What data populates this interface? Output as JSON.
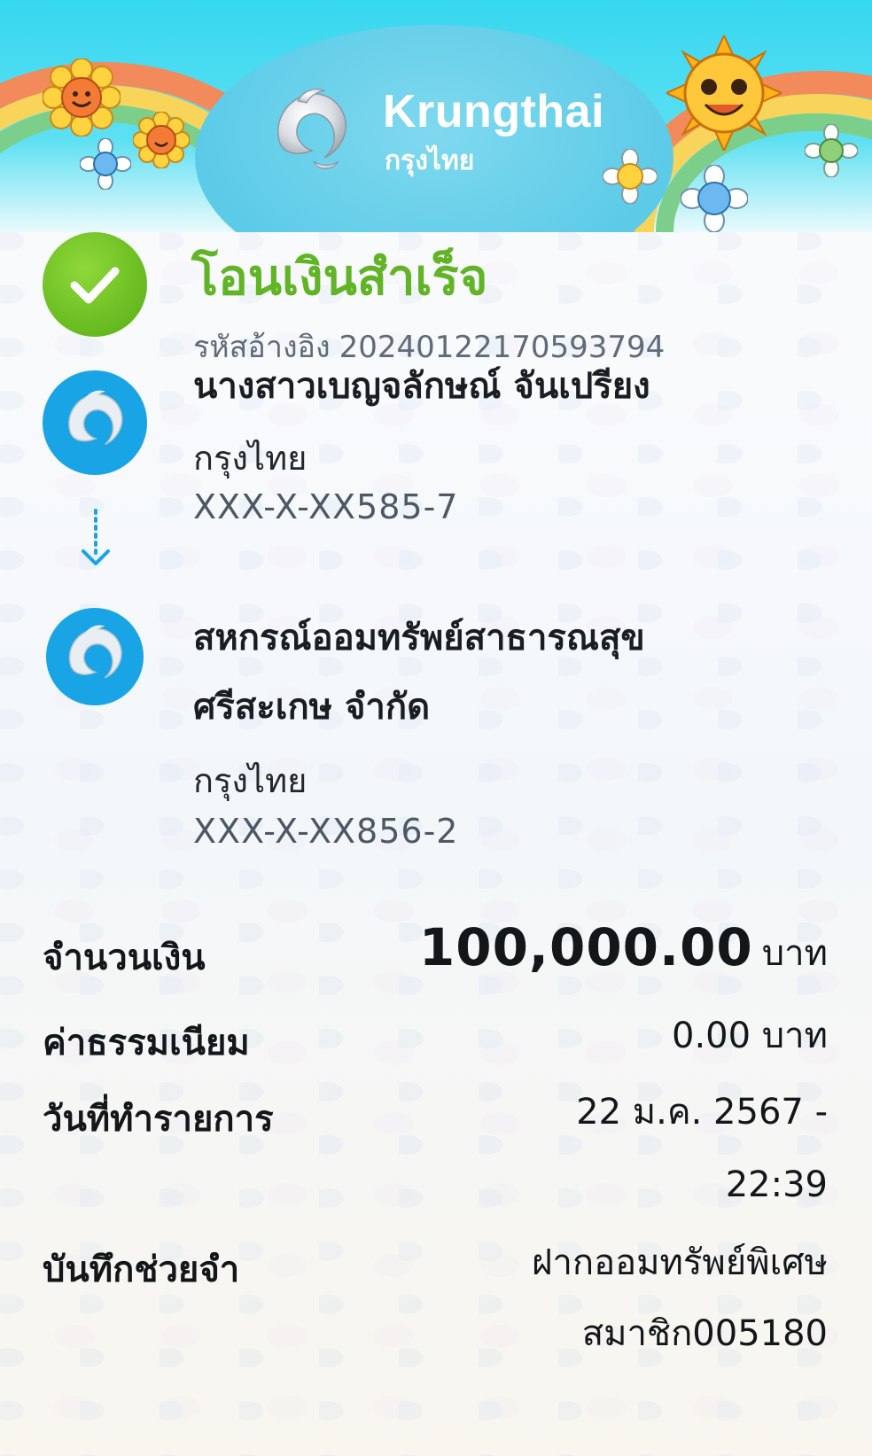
{
  "header": {
    "brand_en": "Krungthai",
    "brand_th": "กรุงไทย",
    "colors": {
      "sky": "#36d7f0",
      "brand_blue": "#19a4e5",
      "success_green": "#61b426"
    }
  },
  "status": {
    "title": "โอนเงินสำเร็จ",
    "ref_label": "รหัสอ้างอิง",
    "ref_value": "2024012217059379​4"
  },
  "from": {
    "name": "นางสาวเบญจลักษณ์ จันเปรียง",
    "bank": "กรุงไทย",
    "account": "XXX-X-XX585-7",
    "icon": "krungthai-bird-icon"
  },
  "to": {
    "name_line1": "สหกรณ์ออมทรัพย์สาธารณสุข",
    "name_line2": "ศรีสะเกษ จำกัด",
    "bank": "กรุงไทย",
    "account": "XXX-X-XX856-2",
    "icon": "krungthai-bird-icon"
  },
  "details": {
    "amount_label": "จำนวนเงิน",
    "amount_value": "100,000.00",
    "amount_unit": "บาท",
    "fee_label": "ค่าธรรมเนียม",
    "fee_value": "0.00 บาท",
    "date_label": "วันที่ทำรายการ",
    "date_line1": "22 ม.ค. 2567 -",
    "date_line2": "22:39",
    "memo_label": "บันทึกช่วยจำ",
    "memo_line1": "ฝากออมทรัพย์พิเศษ",
    "memo_line2": "สมาชิก005180"
  }
}
